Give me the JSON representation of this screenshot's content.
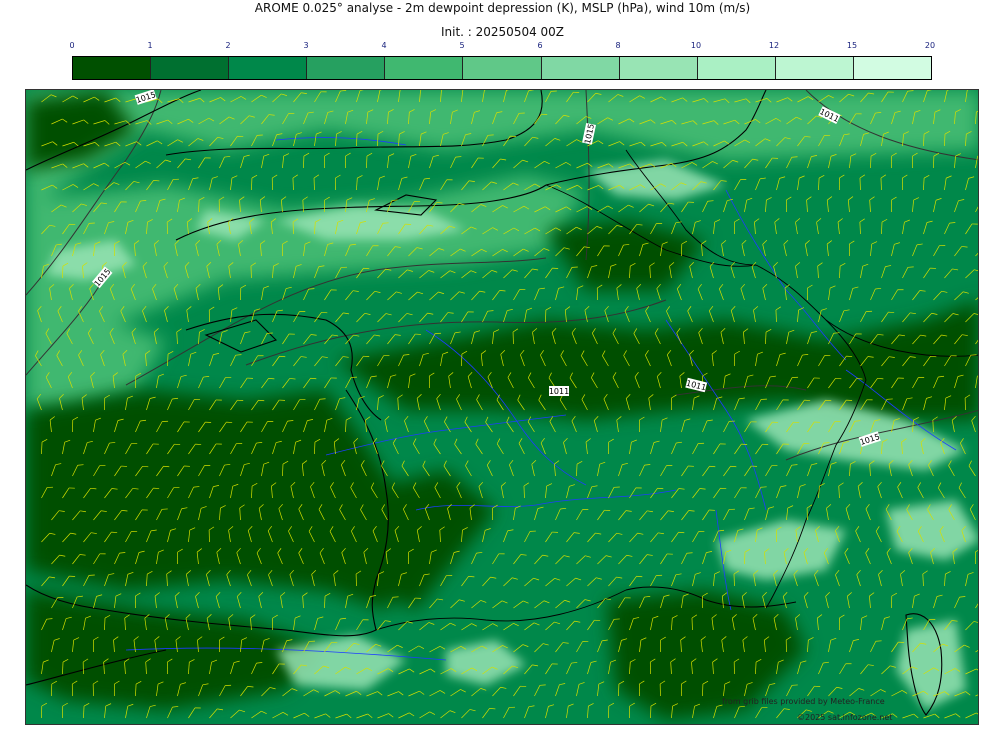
{
  "header": {
    "title": "AROME 0.025° analyse - 2m dewpoint depression (K), MSLP (hPa), wind 10m (m/s)",
    "init": "Init. : 20250504 00Z"
  },
  "colorbar": {
    "ticks": [
      "0",
      "1",
      "2",
      "3",
      "4",
      "5",
      "6",
      "8",
      "10",
      "12",
      "15",
      "20"
    ],
    "colors": [
      "#005000",
      "#007030",
      "#00884a",
      "#26a060",
      "#40b870",
      "#60c888",
      "#80d8a4",
      "#98e4b4",
      "#aaf0c4",
      "#bdf6d2",
      "#d2fce2"
    ],
    "tick_color": "#1a237e"
  },
  "map": {
    "isobar_labels": [
      "1015",
      "1015",
      "1011",
      "1015",
      "1011",
      "1011",
      "1015"
    ],
    "land_color": "#00884a",
    "sea_color": "#40b870",
    "humid_color": "#005000",
    "dry_color": "#98e4b4",
    "wind_barb_color": "#d4e000",
    "river_color": "#1e3cff",
    "coast_color": "#000000",
    "isobar_color": "#333333"
  },
  "credits": {
    "source": "from grib files provided by Meteo-France",
    "copyright": "©2025 sat.infozone.net"
  }
}
